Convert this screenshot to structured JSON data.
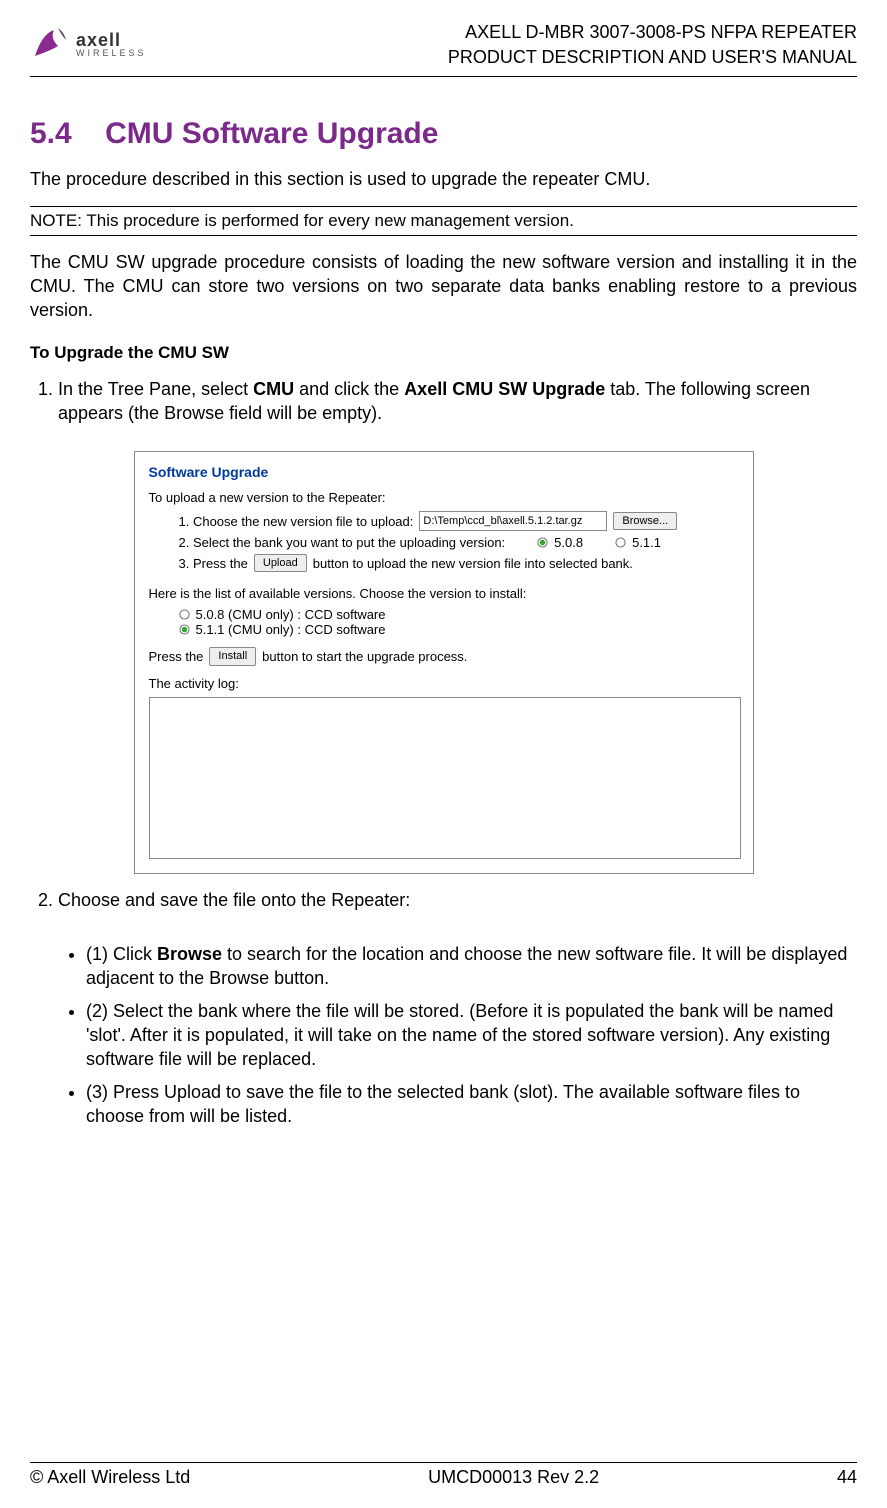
{
  "header": {
    "logo_name": "axell",
    "logo_sub": "WIRELESS",
    "title_line1": "AXELL D-MBR 3007-3008-PS NFPA REPEATER",
    "title_line2": "PRODUCT DESCRIPTION AND USER'S MANUAL"
  },
  "section": {
    "number": "5.4",
    "title": "CMU Software Upgrade"
  },
  "intro": "The procedure described in this section is used to upgrade the repeater CMU.",
  "note": "NOTE: This procedure is performed for every new management version.",
  "desc": "The CMU SW upgrade procedure consists of loading the new software version and installing it in the CMU. The CMU can store two versions on two separate data banks enabling restore to a previous version.",
  "sub_heading": "To Upgrade the CMU SW",
  "step1_pre": "In the Tree Pane, select ",
  "step1_bold1": "CMU",
  "step1_mid": " and click the ",
  "step1_bold2": "Axell CMU SW Upgrade",
  "step1_post": " tab. The following screen appears (the Browse field will be empty).",
  "screenshot": {
    "title": "Software Upgrade",
    "line_intro": "To upload a new version to the Repeater:",
    "s1_label": "1. Choose the new version file to upload:",
    "s1_path": "D:\\Temp\\ccd_bl\\axell.5.1.2.tar.gz",
    "s1_browse": "Browse...",
    "s2_label": "2. Select the bank you want to put the uploading version:",
    "s2_opt1": "5.0.8",
    "s2_opt2": "5.1.1",
    "s3_pre": "3. Press the ",
    "s3_btn": "Upload",
    "s3_post": " button to upload the new version file into selected bank.",
    "avail_label": "Here is the list of available versions. Choose the version to install:",
    "avail_opt1": "5.0.8 (CMU only) : CCD software",
    "avail_opt2": "5.1.1 (CMU only) : CCD software",
    "install_pre": "Press the ",
    "install_btn": "Install",
    "install_post": " button to start the upgrade process.",
    "log_label": "The activity log:"
  },
  "step2": "Choose and save the file onto the Repeater:",
  "bullets": {
    "b1_pre": "(1)  Click ",
    "b1_bold": "Browse",
    "b1_post": " to search for the location and choose the new software file. It will be displayed adjacent to the Browse button.",
    "b2": "(2)  Select the bank where the file will be stored. (Before it is populated the bank will be named 'slot'. After it is populated, it will take on the name of the stored software version). Any existing software file will be replaced.",
    "b3": "(3)  Press Upload to save the file to the selected bank (slot). The available software files to choose from will be listed."
  },
  "footer": {
    "left": "© Axell Wireless Ltd",
    "center": "UMCD00013 Rev 2.2",
    "right": "44"
  }
}
